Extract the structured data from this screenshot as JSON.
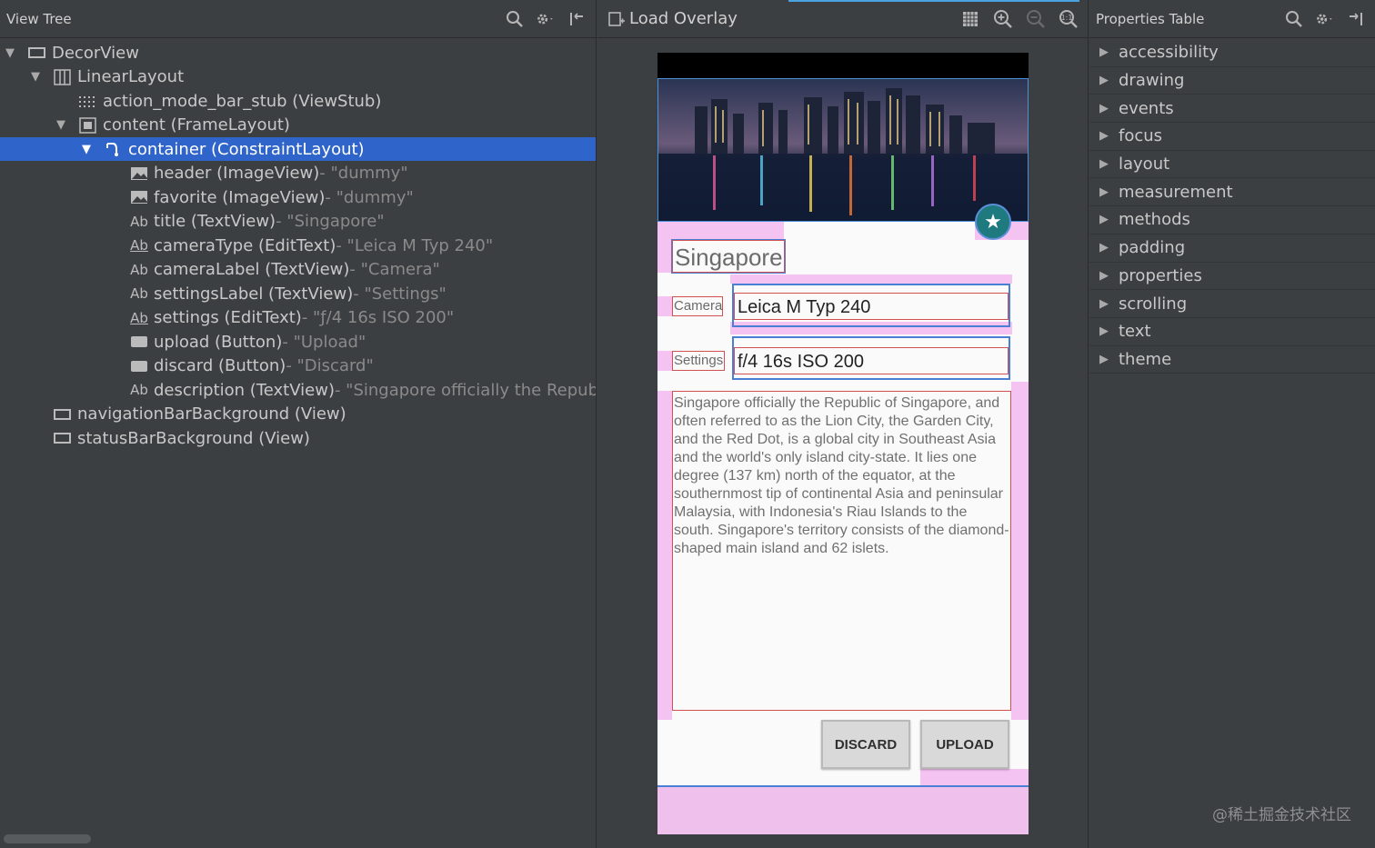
{
  "left_panel": {
    "title": "View Tree",
    "tree": [
      {
        "label": "DecorView",
        "value": "",
        "expanded": true,
        "icon": "view-icon"
      },
      {
        "label": "LinearLayout",
        "value": "",
        "expanded": true,
        "icon": "linearlayout-icon"
      },
      {
        "label": "action_mode_bar_stub (ViewStub)",
        "value": "",
        "icon": "viewstub-icon"
      },
      {
        "label": "content (FrameLayout)",
        "value": "",
        "expanded": true,
        "icon": "framelayout-icon"
      },
      {
        "label": "container (ConstraintLayout)",
        "value": "",
        "expanded": true,
        "selected": true,
        "icon": "constraintlayout-icon"
      },
      {
        "label": "header (ImageView)",
        "value": " - \"dummy\"",
        "icon": "imageview-icon"
      },
      {
        "label": "favorite (ImageView)",
        "value": " - \"dummy\"",
        "icon": "imageview-icon"
      },
      {
        "label": "title (TextView)",
        "value": " - \"Singapore\"",
        "icon": "textview-icon"
      },
      {
        "label": "cameraType (EditText)",
        "value": " - \"Leica M Typ 240\"",
        "icon": "edittext-icon"
      },
      {
        "label": "cameraLabel (TextView)",
        "value": " - \"Camera\"",
        "icon": "textview-icon"
      },
      {
        "label": "settingsLabel (TextView)",
        "value": " - \"Settings\"",
        "icon": "textview-icon"
      },
      {
        "label": "settings (EditText)",
        "value": " - \"ƒ/4 16s ISO 200\"",
        "icon": "edittext-icon"
      },
      {
        "label": "upload (Button)",
        "value": " - \"Upload\"",
        "icon": "button-icon"
      },
      {
        "label": "discard (Button)",
        "value": " - \"Discard\"",
        "icon": "button-icon"
      },
      {
        "label": "description (TextView)",
        "value": " - \"Singapore officially the Republi",
        "icon": "textview-icon"
      },
      {
        "label": "navigationBarBackground (View)",
        "value": "",
        "icon": "view-icon"
      },
      {
        "label": "statusBarBackground (View)",
        "value": "",
        "icon": "view-icon"
      }
    ]
  },
  "center_panel": {
    "title": "Load Overlay",
    "device": {
      "title": "Singapore",
      "camera_label": "Camera",
      "camera_value": "Leica M Typ 240",
      "settings_label": "Settings",
      "settings_value": "f/4 16s ISO 200",
      "description": "Singapore officially the Republic of Singapore, and often referred to as the Lion City, the Garden City, and the Red Dot, is a global city in Southeast Asia and the world's only island city-state. It lies one degree (137 km) north of the equator, at the southernmost tip of continental Asia and peninsular Malaysia, with Indonesia's Riau Islands to the south. Singapore's territory consists of the diamond-shaped main island and 62 islets.",
      "discard_label": "DISCARD",
      "upload_label": "UPLOAD"
    }
  },
  "right_panel": {
    "title": "Properties Table",
    "properties": [
      "accessibility",
      "drawing",
      "events",
      "focus",
      "layout",
      "measurement",
      "methods",
      "padding",
      "properties",
      "scrolling",
      "text",
      "theme"
    ]
  },
  "watermark": "@稀土掘金技术社区",
  "colors": {
    "panel_bg": "#3c3f41",
    "selection": "#2f65ca",
    "overlay_pink": "#f2b8ef",
    "fab": "#1f7a80"
  }
}
